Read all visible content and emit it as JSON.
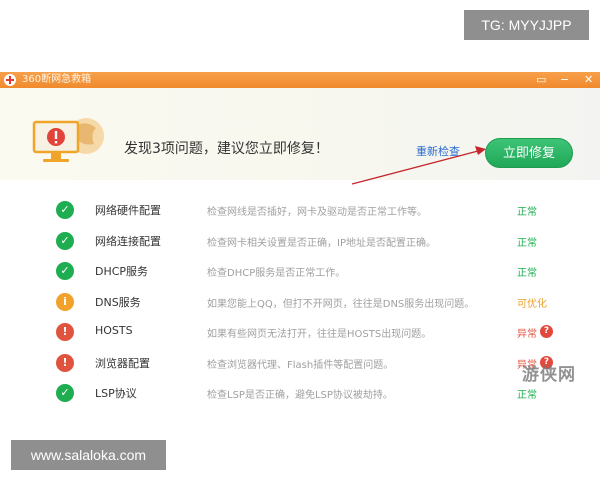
{
  "overlay": {
    "tg_label": "TG: MYYJJPP",
    "url_label": "www.salaloka.com",
    "watermark_text": "游侠网"
  },
  "window": {
    "title": "360断网急救箱",
    "controls": [
      "▭",
      "−",
      "✕"
    ]
  },
  "banner": {
    "headline": "发现3项问题，建议您立即修复！",
    "recheck_label": "重新检查",
    "repair_label": "立即修复"
  },
  "colors": {
    "ok": "#1fad52",
    "warn": "#f2a22c",
    "error": "#e0543f",
    "accent": "#f08a2c",
    "link": "#2b6ccf"
  },
  "items": [
    {
      "name": "网络硬件配置",
      "desc": "检查网线是否插好，网卡及驱动是否正常工作等。",
      "status": "正常",
      "state": "ok",
      "icon": "check-icon"
    },
    {
      "name": "网络连接配置",
      "desc": "检查网卡相关设置是否正确，IP地址是否配置正确。",
      "status": "正常",
      "state": "ok",
      "icon": "check-icon"
    },
    {
      "name": "DHCP服务",
      "desc": "检查DHCP服务是否正常工作。",
      "status": "正常",
      "state": "ok",
      "icon": "check-icon"
    },
    {
      "name": "DNS服务",
      "desc": "如果您能上QQ，但打不开网页，往往是DNS服务出现问题。",
      "status": "可优化",
      "state": "warn",
      "icon": "info-icon"
    },
    {
      "name": "HOSTS",
      "desc": "如果有些网页无法打开，往往是HOSTS出现问题。",
      "status": "异常",
      "state": "error",
      "icon": "alert-icon"
    },
    {
      "name": "浏览器配置",
      "desc": "检查浏览器代理、Flash插件等配置问题。",
      "status": "异常",
      "state": "error",
      "icon": "alert-icon"
    },
    {
      "name": "LSP协议",
      "desc": "检查LSP是否正确，避免LSP协议被劫持。",
      "status": "正常",
      "state": "ok",
      "icon": "check-icon"
    }
  ]
}
